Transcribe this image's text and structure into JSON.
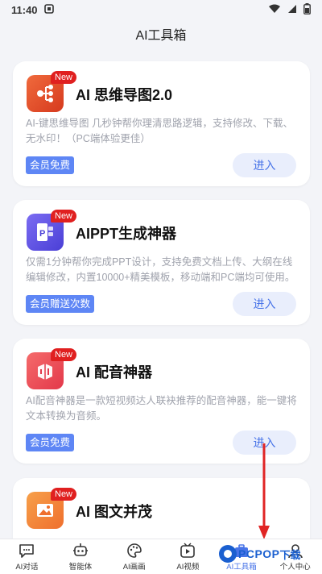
{
  "status": {
    "time": "11:40"
  },
  "header": {
    "title": "AI工具箱"
  },
  "tools": [
    {
      "badge": "New",
      "title": "AI 思维导图2.0",
      "desc": "AI-键思维导图 几秒钟帮你理清思路逻辑，支持修改、下载、无水印！（PC端体验更佳）",
      "tag": "会员免费",
      "button": "进入",
      "icon": "mindmap-icon"
    },
    {
      "badge": "New",
      "title": "AIPPT生成神器",
      "desc": "仅需1分钟帮你完成PPT设计，支持免费文档上传、大纲在线编辑修改，内置10000+精美模板，移动端和PC端均可使用。",
      "tag": "会员赠送次数",
      "button": "进入",
      "icon": "ppt-icon"
    },
    {
      "badge": "New",
      "title": "AI 配音神器",
      "desc": "AI配音神器是一款短视频达人联袂推荐的配音神器，能一键将文本转换为音频。",
      "tag": "会员免费",
      "button": "进入",
      "icon": "dubbing-icon"
    },
    {
      "badge": "New",
      "title": "AI 图文并茂",
      "icon": "image-text-icon"
    }
  ],
  "tabbar": {
    "items": [
      {
        "label": "AI对话",
        "icon": "chat-icon"
      },
      {
        "label": "智能体",
        "icon": "robot-icon"
      },
      {
        "label": "AI画画",
        "icon": "palette-icon"
      },
      {
        "label": "AI视频",
        "icon": "video-icon"
      },
      {
        "label": "AI工具箱",
        "icon": "toolbox-icon",
        "active": true
      },
      {
        "label": "个人中心",
        "icon": "person-icon"
      }
    ]
  },
  "watermark": {
    "brand": "PCPOP",
    "suffix": "下载"
  },
  "colors": {
    "accent": "#4874e8",
    "tag": "#5e86f5",
    "badge": "#e02020",
    "arrow": "#e02424"
  }
}
